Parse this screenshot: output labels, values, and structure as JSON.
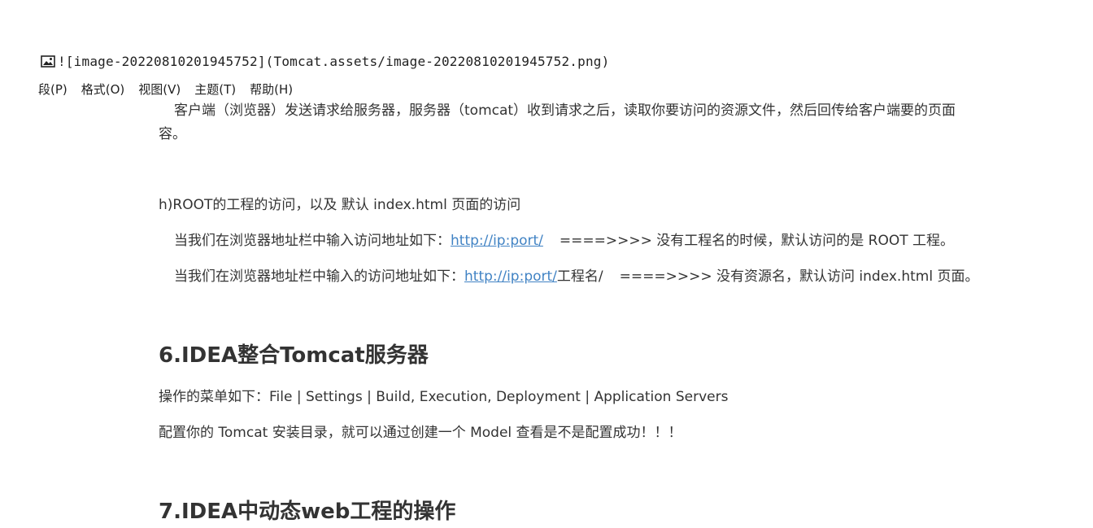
{
  "image_ref": {
    "icon": "image-icon",
    "text": "![image-20220810201945752](Tomcat.assets/image-20220810201945752.png)"
  },
  "menubar": {
    "items": [
      "段(P)",
      "格式(O)",
      "视图(V)",
      "主题(T)",
      "帮助(H)"
    ]
  },
  "content": {
    "para1_line1": "客户端（浏览器）发送请求给服务器，服务器（tomcat）收到请求之后，读取你要访问的资源文件，然后回传给客户端要的页面",
    "para1_line2": "容。",
    "root_heading": "h)ROOT的工程的访问，以及 默认 index.html 页面的访问",
    "line_a": {
      "prefix": "当我们在浏览器地址栏中输入访问地址如下：",
      "link": "http://ip:port/",
      "suffix": "====>>>> 没有工程名的时候，默认访问的是 ROOT 工程。"
    },
    "line_b": {
      "prefix": "当我们在浏览器地址栏中输入的访问地址如下：",
      "link": "http://ip:port/",
      "middle": "工程名/",
      "suffix": "====>>>> 没有资源名，默认访问 index.html 页面。"
    },
    "section6": {
      "title": "6.IDEA整合Tomcat服务器",
      "line1": "操作的菜单如下：File | Settings | Build, Execution, Deployment | Application Servers",
      "line2": "配置你的 Tomcat 安装目录，就可以通过创建一个 Model 查看是不是配置成功！！！"
    },
    "section7": {
      "title": "7.IDEA中动态web工程的操作"
    }
  }
}
